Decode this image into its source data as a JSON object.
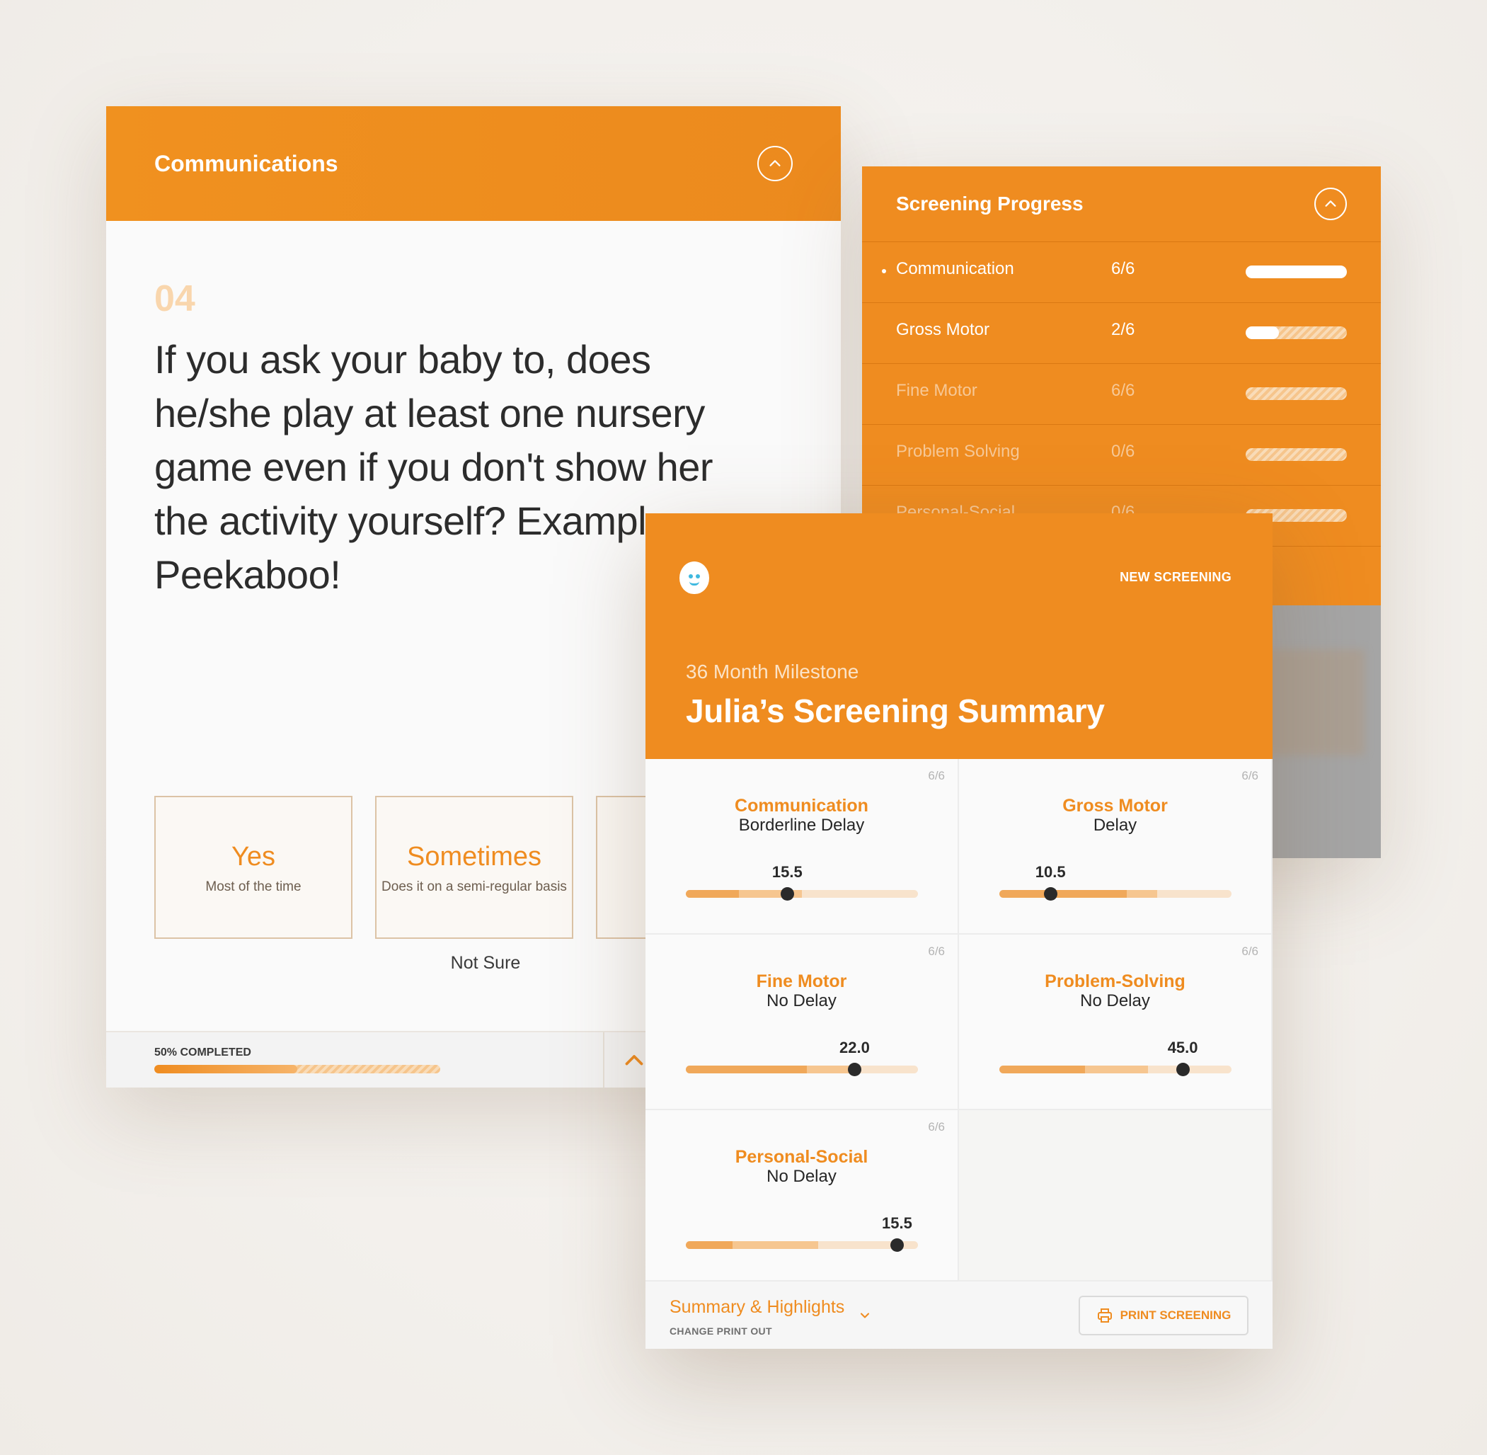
{
  "question_card": {
    "title": "Communications",
    "number": "04",
    "question": "If you ask your baby to, does he/she play at least one nursery game even if you don't show her the activity yourself? Example: Peekaboo!",
    "options": [
      {
        "title": "Yes",
        "subtitle": "Most of the time"
      },
      {
        "title": "Sometimes",
        "subtitle": "Does it on a semi-regular basis"
      }
    ],
    "not_sure": "Not Sure",
    "progress_label": "50% COMPLETED",
    "progress_fraction": 0.5
  },
  "progress_card": {
    "title": "Screening Progress",
    "rows": [
      {
        "name": "Communication",
        "count": "6/6",
        "fraction": 1.0,
        "active": true
      },
      {
        "name": "Gross Motor",
        "count": "2/6",
        "fraction": 0.33,
        "active": false
      },
      {
        "name": "Fine Motor",
        "count": "6/6",
        "fraction": 0.0,
        "active": false
      },
      {
        "name": "Problem Solving",
        "count": "0/6",
        "fraction": 0.0,
        "active": false
      },
      {
        "name": "Personal-Social",
        "count": "0/6",
        "fraction": 0.0,
        "active": false
      }
    ]
  },
  "summary_card": {
    "new_screening": "NEW SCREENING",
    "milestone": "36 Month Milestone",
    "title": "Julia’s Screening Summary",
    "domains": [
      {
        "name": "Communication",
        "status": "Borderline Delay",
        "count": "6/6",
        "score": "15.5",
        "score_fraction": 0.437,
        "zone1": 0.23,
        "zone2": 0.5
      },
      {
        "name": "Gross Motor",
        "status": "Delay",
        "count": "6/6",
        "score": "10.5",
        "score_fraction": 0.22,
        "zone1": 0.55,
        "zone2": 0.68
      },
      {
        "name": "Fine Motor",
        "status": "No Delay",
        "count": "6/6",
        "score": "22.0",
        "score_fraction": 0.727,
        "zone1": 0.52,
        "zone2": 0.72
      },
      {
        "name": "Problem-Solving",
        "status": "No Delay",
        "count": "6/6",
        "score": "45.0",
        "score_fraction": 0.79,
        "zone1": 0.37,
        "zone2": 0.64
      },
      {
        "name": "Personal-Social",
        "status": "No Delay",
        "count": "6/6",
        "score": "15.5",
        "score_fraction": 0.91,
        "zone1": 0.2,
        "zone2": 0.57
      }
    ],
    "footer": {
      "summary_label": "Summary & Highlights",
      "change_label": "CHANGE PRINT OUT",
      "print_label": "PRINT SCREENING"
    }
  },
  "icons": [
    "chevron-up-circle-icon",
    "chevron-up-icon",
    "chevron-down-icon",
    "printer-icon",
    "app-logo"
  ],
  "colors": {
    "accent": "#ef8c20",
    "text": "#2b2b2b"
  }
}
